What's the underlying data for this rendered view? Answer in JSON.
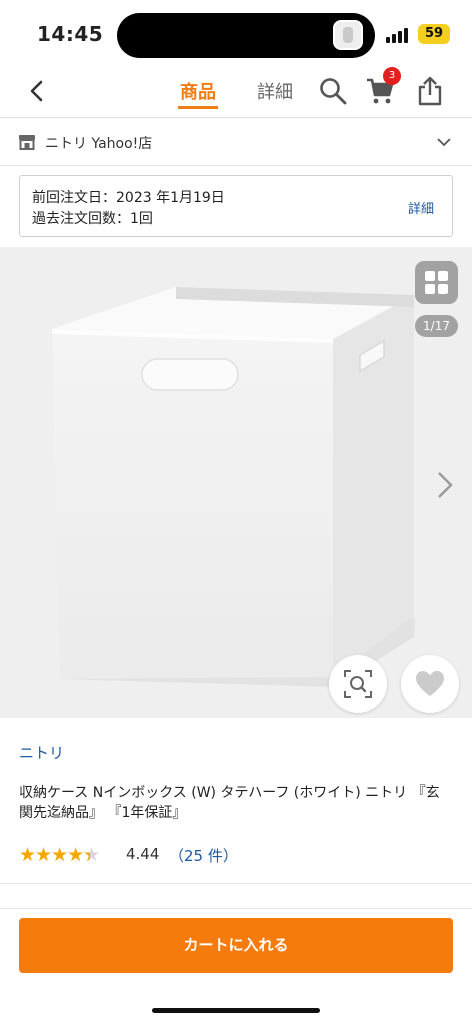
{
  "status_bar": {
    "time": "14:45",
    "battery": "59"
  },
  "nav": {
    "tabs": [
      {
        "label": "商品",
        "active": true
      },
      {
        "label": "詳細",
        "active": false
      }
    ],
    "cart_count": "3",
    "accent": "#f07d16"
  },
  "store": {
    "name": "ニトリ Yahoo!店"
  },
  "order_history": {
    "last_order": "前回注文日：2023 年1月19日",
    "count": "過去注文回数：1回",
    "detail_link": "詳細"
  },
  "gallery": {
    "counter": "1/17"
  },
  "product": {
    "brand": "ニトリ",
    "title": "収納ケース Nインボックス (W) タテハーフ (ホワイト) ニトリ 『玄関先迄納品』 『1年保証』",
    "rating_value": "4.44",
    "stars": 4.44,
    "review_count": "（25 件）"
  },
  "actions": {
    "add_to_cart": "カートに入れる",
    "button_color": "#f57c0c"
  }
}
